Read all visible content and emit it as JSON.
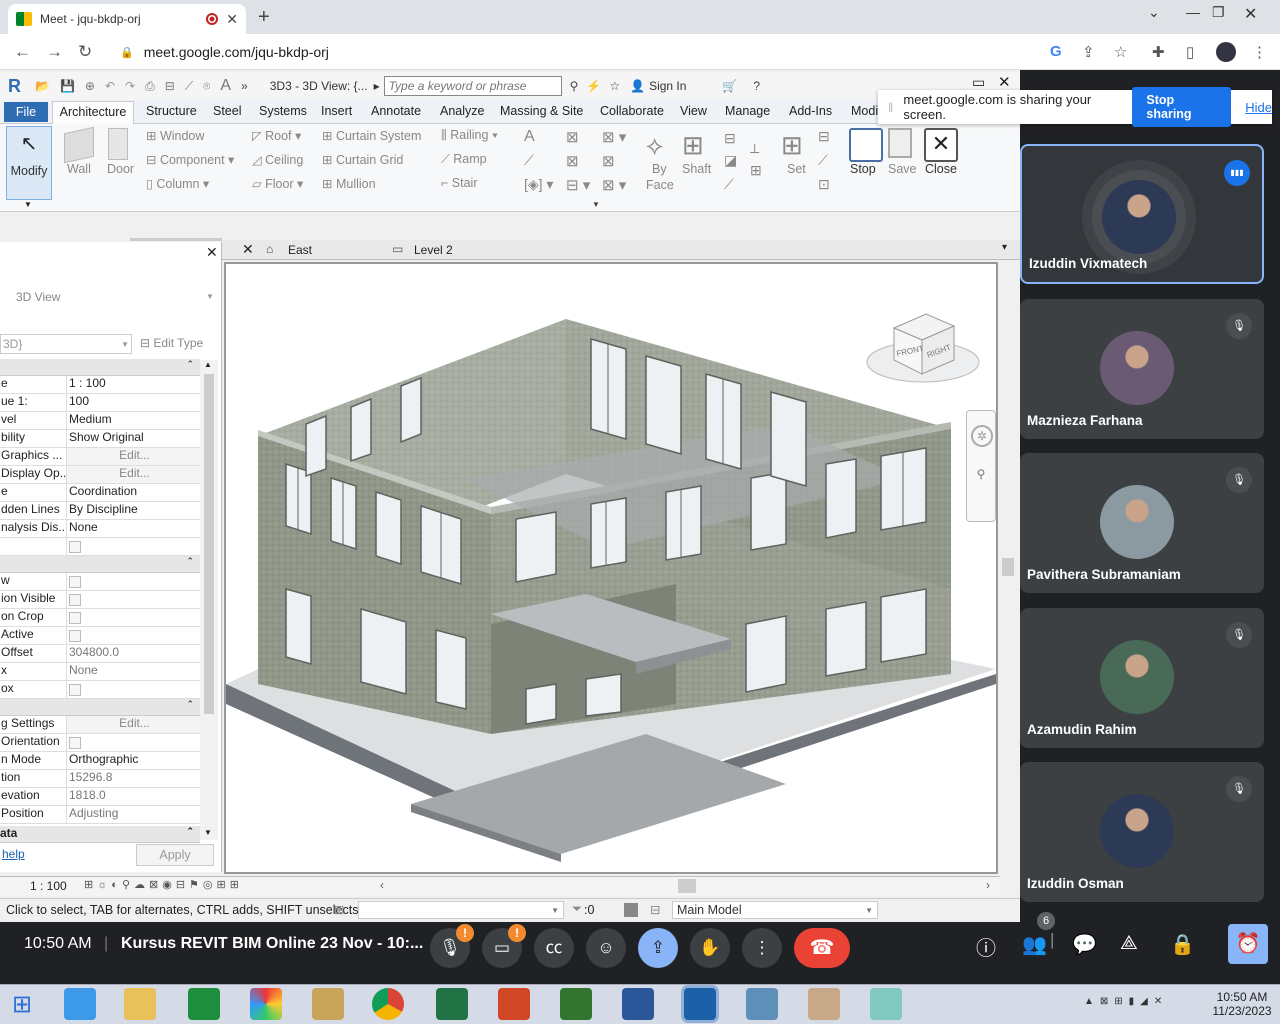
{
  "browser": {
    "tab_title": "Meet - jqu-bkdp-orj",
    "url": "meet.google.com/jqu-bkdp-orj"
  },
  "revit": {
    "view_title": "3D3 - 3D View: {...",
    "search_placeholder": "Type a keyword or phrase",
    "sign_in": "Sign In",
    "tabs": [
      "File",
      "Architecture",
      "Structure",
      "Steel",
      "Systems",
      "Insert",
      "Annotate",
      "Analyze",
      "Massing & Site",
      "Collaborate",
      "View",
      "Manage",
      "Add-Ins",
      "Modi"
    ],
    "ribbon": {
      "modify": "Modify",
      "wall": "Wall",
      "door": "Door",
      "window": "Window",
      "component": "Component",
      "column": "Column",
      "roof": "Roof",
      "ceiling": "Ceiling",
      "floor": "Floor",
      "curtain_system": "Curtain System",
      "curtain_grid": "Curtain Grid",
      "mullion": "Mullion",
      "railing": "Railing",
      "ramp": "Ramp",
      "stair": "Stair",
      "by_face_1": "By",
      "by_face_2": "Face",
      "shaft": "Shaft",
      "set": "Set",
      "stop": "Stop",
      "save": "Save",
      "close": "Close"
    },
    "view_tabs": [
      "East",
      "Level 2"
    ],
    "properties": {
      "type_name": "3D View",
      "selector": "3D}",
      "edit_type": "Edit Type",
      "rows1": [
        {
          "k": "e",
          "v": "1 : 100"
        },
        {
          "k": "ue   1:",
          "v": "100"
        },
        {
          "k": "vel",
          "v": "Medium"
        },
        {
          "k": "bility",
          "v": "Show Original"
        },
        {
          "k": "Graphics ...",
          "v": "Edit..."
        },
        {
          "k": "Display Op...",
          "v": "Edit..."
        },
        {
          "k": "e",
          "v": "Coordination"
        },
        {
          "k": "dden Lines",
          "v": "By Discipline"
        },
        {
          "k": "nalysis Dis...",
          "v": "None"
        },
        {
          "k": "",
          "v": ""
        }
      ],
      "rows2": [
        {
          "k": "w",
          "v": ""
        },
        {
          "k": "ion Visible",
          "v": ""
        },
        {
          "k": "on Crop",
          "v": ""
        },
        {
          "k": "Active",
          "v": ""
        },
        {
          "k": "Offset",
          "v": "304800.0"
        },
        {
          "k": "x",
          "v": "None"
        },
        {
          "k": "ox",
          "v": ""
        }
      ],
      "rows3": [
        {
          "k": "g Settings",
          "v": "Edit..."
        },
        {
          "k": "Orientation",
          "v": ""
        },
        {
          "k": "n Mode",
          "v": "Orthographic"
        },
        {
          "k": "tion",
          "v": "15296.8"
        },
        {
          "k": "evation",
          "v": "1818.0"
        },
        {
          "k": "Position",
          "v": "Adjusting"
        }
      ],
      "last_group": "ata",
      "help": "help",
      "apply": "Apply"
    },
    "viewcube": {
      "front": "FRONT",
      "right": "RIGHT"
    },
    "scale": "1 : 100",
    "status_text": "Click to select, TAB for alternates, CTRL adds, SHIFT unselects",
    "selection_count": ":0",
    "model": "Main Model"
  },
  "meet": {
    "sharing_text": "meet.google.com is sharing your screen.",
    "stop_sharing": "Stop sharing",
    "hide": "Hide",
    "participants": [
      {
        "name": "Izuddin Vixmatech",
        "speaking": true,
        "color": "#2d3a55"
      },
      {
        "name": "Maznieza Farhana",
        "speaking": false,
        "color": "#6a5a74"
      },
      {
        "name": "Pavithera Subramaniam",
        "speaking": false,
        "color": "#8a9aa0"
      },
      {
        "name": "Azamudin Rahim",
        "speaking": false,
        "color": "#4a6a58"
      },
      {
        "name": "Izuddin Osman",
        "speaking": false,
        "color": "#2d3a55"
      }
    ],
    "time": "10:50 AM",
    "meeting_title": "Kursus REVIT BIM Online 23 Nov - 10:...",
    "people_count": "6"
  },
  "taskbar": {
    "time": "10:50 AM",
    "date": "11/23/2023"
  }
}
